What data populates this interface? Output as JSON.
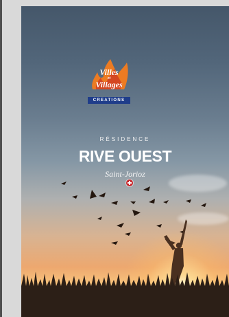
{
  "brand": {
    "line1": "Villes",
    "small_word": "et",
    "line2": "Villages",
    "band": "CREATIONS"
  },
  "cover": {
    "kicker": "RÉSIDENCE",
    "title": "RIVE OUEST",
    "place": "Saint-Jorioz"
  },
  "icons": {
    "logo": "flame-logo",
    "flag": "savoy-cross-icon"
  },
  "colors": {
    "sky_top": "#45576a",
    "sunset": "#f9c67e",
    "logo_orange": "#e56a24",
    "logo_band": "#1f3d8a",
    "savoy_red": "#c9282d"
  }
}
